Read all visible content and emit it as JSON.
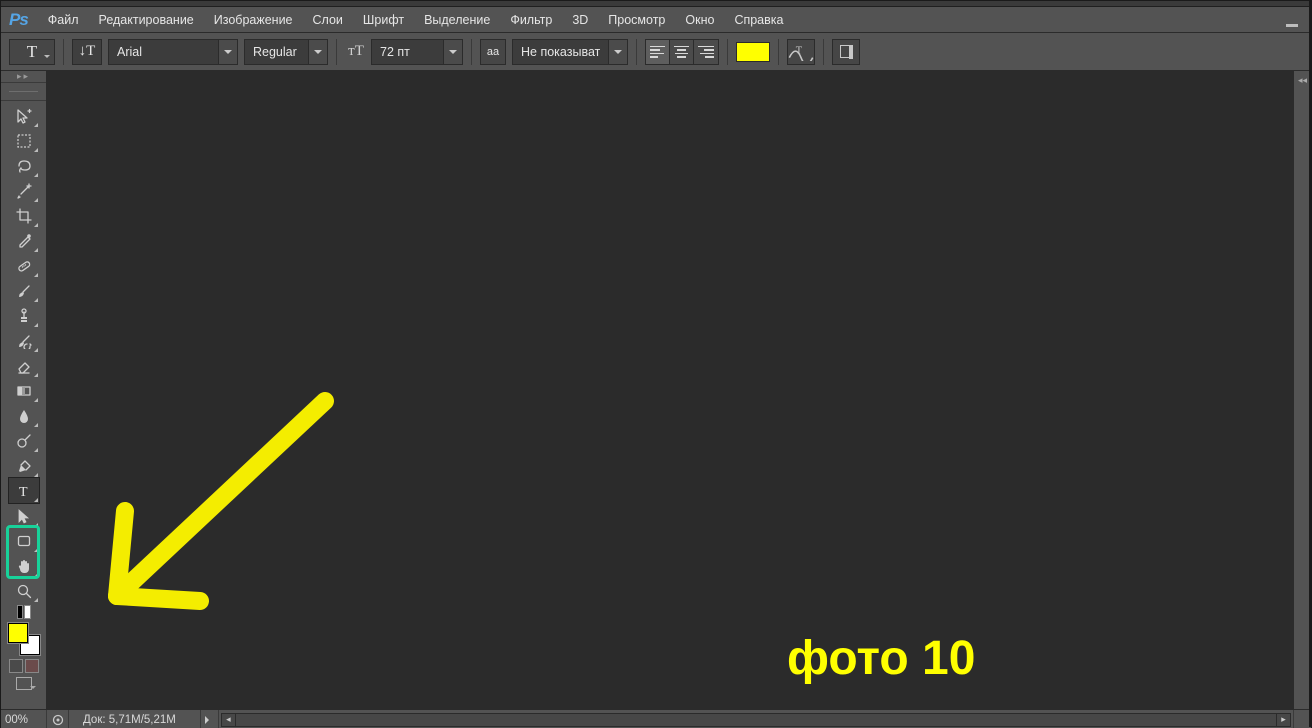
{
  "app": {
    "logo": "Ps"
  },
  "menu": {
    "items": [
      "Файл",
      "Редактирование",
      "Изображение",
      "Слои",
      "Шрифт",
      "Выделение",
      "Фильтр",
      "3D",
      "Просмотр",
      "Окно",
      "Справка"
    ]
  },
  "options": {
    "tool_letter": "T",
    "font_family": "Arial",
    "font_weight": "Regular",
    "size_label_icon": "тT",
    "font_size": "72 пт",
    "aa_icon": "aa",
    "antialias": "Не показывать",
    "text_color": "#ffff00"
  },
  "tools": {
    "items": [
      {
        "name": "move-tool",
        "svg": "move"
      },
      {
        "name": "marquee-tool",
        "svg": "marquee"
      },
      {
        "name": "lasso-tool",
        "svg": "lasso"
      },
      {
        "name": "magic-wand-tool",
        "svg": "wand"
      },
      {
        "name": "crop-tool",
        "svg": "crop"
      },
      {
        "name": "eyedropper-tool",
        "svg": "eyedrop"
      },
      {
        "name": "healing-brush-tool",
        "svg": "bandaid"
      },
      {
        "name": "brush-tool",
        "svg": "brush"
      },
      {
        "name": "clone-stamp-tool",
        "svg": "stamp"
      },
      {
        "name": "history-brush-tool",
        "svg": "histbrush"
      },
      {
        "name": "eraser-tool",
        "svg": "eraser"
      },
      {
        "name": "gradient-tool",
        "svg": "gradient"
      },
      {
        "name": "blur-tool",
        "svg": "drop"
      },
      {
        "name": "dodge-tool",
        "svg": "dodge"
      },
      {
        "name": "pen-tool",
        "svg": "pen"
      },
      {
        "name": "type-tool",
        "svg": "type",
        "active": true
      },
      {
        "name": "path-select-tool",
        "svg": "pathsel"
      },
      {
        "name": "rectangle-tool",
        "svg": "rect"
      },
      {
        "name": "hand-tool",
        "svg": "hand"
      },
      {
        "name": "zoom-tool",
        "svg": "zoom"
      }
    ],
    "fg_color": "#ffff00",
    "bg_color": "#ffffff"
  },
  "annotation": {
    "arrow_color": "#f4ed00",
    "label": "фото 10",
    "label_color": "#ffff00",
    "highlight_color": "#18d29a"
  },
  "status": {
    "zoom": "00%",
    "doc_size": "Док: 5,71M/5,21M"
  }
}
